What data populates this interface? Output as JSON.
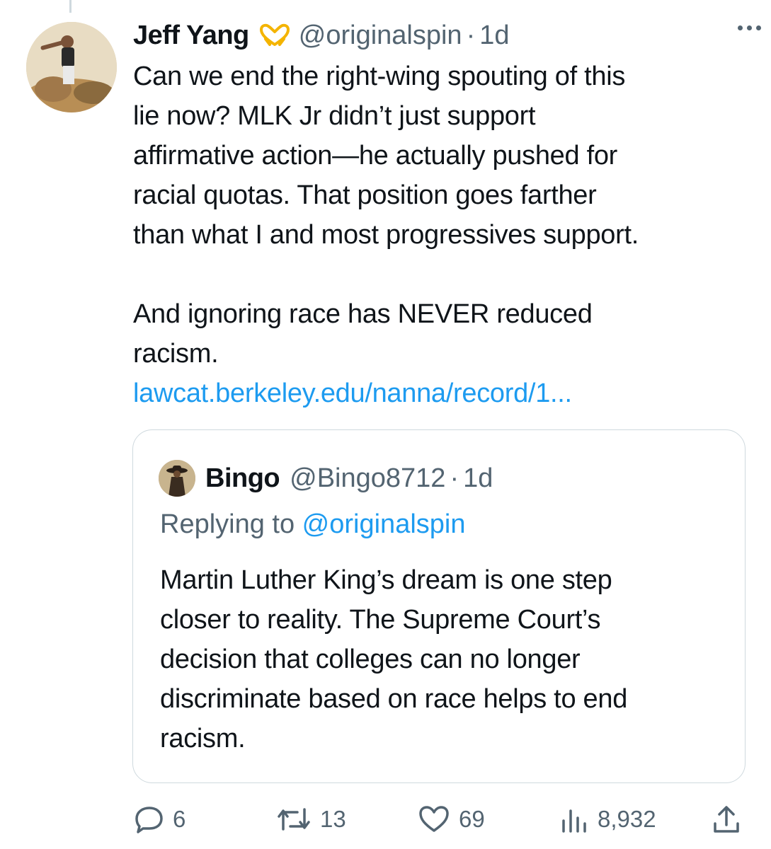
{
  "tweet": {
    "author_name": "Jeff Yang",
    "badge_icon": "heart-hands-emoji",
    "handle": "@originalspin",
    "separator": "·",
    "time": "1d",
    "paragraph_1": "Can we end the right-wing spouting of this\nlie now? MLK Jr didn’t just support\naffirmative action—he actually pushed for\nracial quotas. That position goes farther\nthan what I and most progressives support.",
    "paragraph_2": "And ignoring race has NEVER reduced\nracism.",
    "link_text": "lawcat.berkeley.edu/nanna/record/1..."
  },
  "quoted_tweet": {
    "author_name": "Bingo",
    "handle": "@Bingo8712",
    "separator": "·",
    "time": "1d",
    "replying_prefix": "Replying to ",
    "replying_handle": "@originalspin",
    "text": "Martin Luther King’s dream is one step\ncloser to reality. The Supreme Court’s\ndecision that colleges can no longer\ndiscriminate based on race helps to end\nracism."
  },
  "actions": {
    "replies": "6",
    "retweets": "13",
    "likes": "69",
    "views": "8,932"
  },
  "colors": {
    "text": "#0f1419",
    "secondary": "#536471",
    "link": "#1d9bf0",
    "border": "#cfd9de"
  }
}
